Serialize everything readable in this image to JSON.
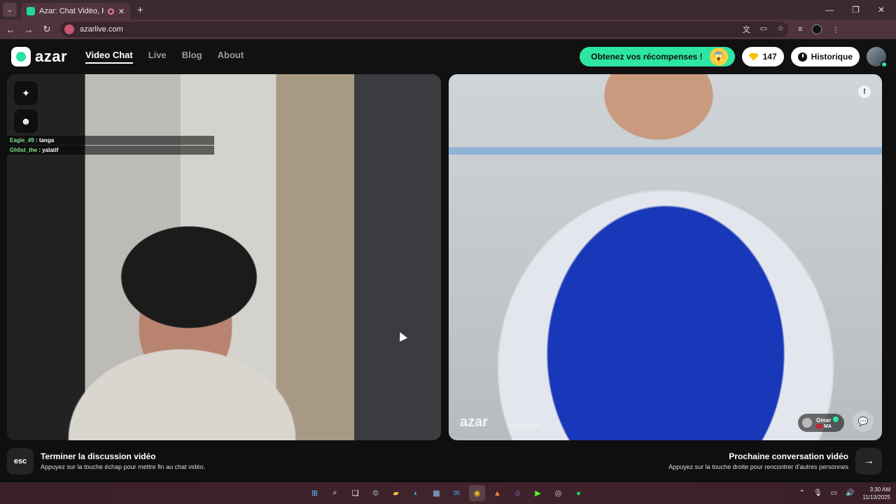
{
  "browser": {
    "tab_title": "Azar: Chat Vidéo, Rencontr",
    "url": "azarlive.com",
    "icons": [
      "tab-search-icon",
      "close-icon",
      "new-tab-icon",
      "back-icon",
      "forward-icon",
      "reload-icon",
      "translate-icon",
      "cast-icon",
      "bookmark-star-icon",
      "reading-list-icon",
      "profile-icon",
      "menu-dots-icon",
      "minimize-icon",
      "maximize-icon",
      "close-window-icon"
    ]
  },
  "header": {
    "logo_text": "azar",
    "nav": [
      {
        "label": "Video Chat",
        "active": true
      },
      {
        "label": "Live",
        "active": false
      },
      {
        "label": "Blog",
        "active": false
      },
      {
        "label": "About",
        "active": false
      }
    ],
    "reward_label": "Obtenez vos récompenses !",
    "gems": "147",
    "history_label": "Historique",
    "accent_color": "#2ee6a4"
  },
  "left_video": {
    "chat": [
      {
        "user": "Eagle_49",
        "message": " : tanga"
      },
      {
        "user": "Gh0st_the",
        "message": " : yalatif"
      }
    ]
  },
  "right_video": {
    "watermark": "azar",
    "watermark_id": "fe3Gu7RZab7",
    "peer_name": "Omar",
    "peer_country": "MA"
  },
  "controls": {
    "esc_key": "esc",
    "end_title": "Terminer la discussion vidéo",
    "end_sub": "Appuyez sur la touche échap pour mettre fin au chat vidéo.",
    "next_title": "Prochaine conversation vidéo",
    "next_sub": "Appuyez sur la touche droite pour rencontrer d'autres personnes"
  },
  "taskbar": {
    "time": "3:30 AM",
    "date": "11/13/2025"
  }
}
